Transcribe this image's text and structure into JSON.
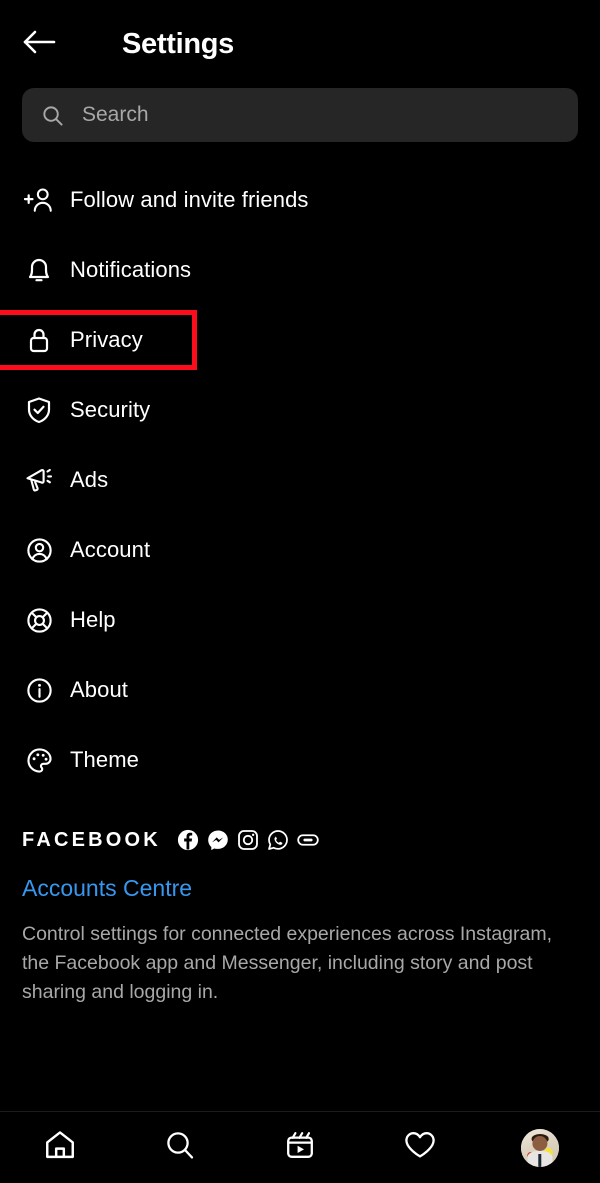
{
  "header": {
    "back_icon": "arrow-left-icon",
    "title": "Settings"
  },
  "search": {
    "icon": "search-icon",
    "placeholder": "Search",
    "value": ""
  },
  "menu": {
    "items": [
      {
        "label": "Follow and invite friends",
        "icon": "person-add-icon",
        "highlighted": false
      },
      {
        "label": "Notifications",
        "icon": "bell-icon",
        "highlighted": false
      },
      {
        "label": "Privacy",
        "icon": "lock-icon",
        "highlighted": true
      },
      {
        "label": "Security",
        "icon": "shield-check-icon",
        "highlighted": false
      },
      {
        "label": "Ads",
        "icon": "megaphone-icon",
        "highlighted": false
      },
      {
        "label": "Account",
        "icon": "person-circle-icon",
        "highlighted": false
      },
      {
        "label": "Help",
        "icon": "life-ring-icon",
        "highlighted": false
      },
      {
        "label": "About",
        "icon": "info-circle-icon",
        "highlighted": false
      },
      {
        "label": "Theme",
        "icon": "palette-icon",
        "highlighted": false
      }
    ]
  },
  "facebook_section": {
    "brand_label": "FACEBOOK",
    "brand_icons": [
      "facebook-icon",
      "messenger-icon",
      "instagram-icon",
      "whatsapp-icon",
      "oculus-icon"
    ],
    "link_label": "Accounts Centre",
    "description": "Control settings for connected experiences across Instagram, the Facebook app and Messenger, including story and post sharing and logging in."
  },
  "bottom_nav": {
    "items": [
      {
        "name": "home",
        "icon": "home-icon"
      },
      {
        "name": "search",
        "icon": "search-icon"
      },
      {
        "name": "reels",
        "icon": "reels-icon"
      },
      {
        "name": "activity",
        "icon": "heart-icon"
      },
      {
        "name": "profile",
        "icon": "avatar-icon"
      }
    ]
  },
  "colors": {
    "background": "#000000",
    "search_field": "#262626",
    "link_blue": "#3797ef",
    "muted_text": "#a8a8a8",
    "highlight_red": "#fc0d1b"
  }
}
